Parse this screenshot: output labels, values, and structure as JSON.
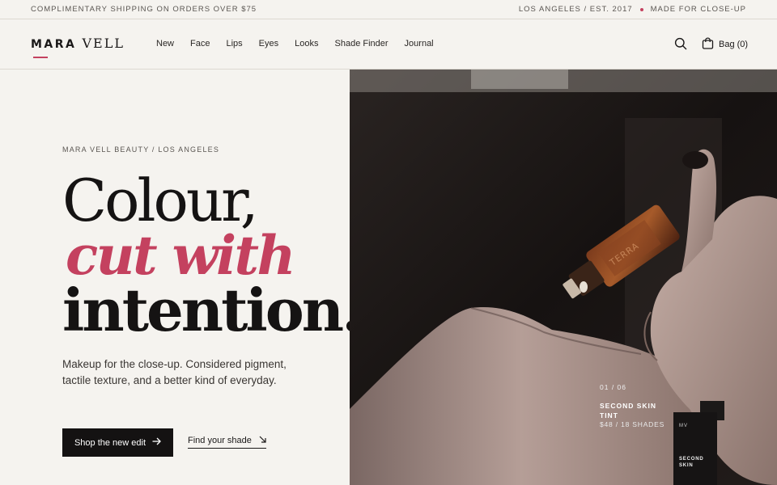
{
  "announcement": {
    "left": "COMPLIMENTARY SHIPPING ON ORDERS OVER $75",
    "right_a": "LOS ANGELES / EST. 2017",
    "right_b": "MADE FOR CLOSE-UP"
  },
  "brand": {
    "first": "MARA",
    "second": "VELL"
  },
  "nav": [
    "New",
    "Face",
    "Lips",
    "Eyes",
    "Looks",
    "Shade Finder",
    "Journal"
  ],
  "header": {
    "bag_label": "Bag (0)",
    "search_icon": "search-icon",
    "bag_icon": "bag-icon"
  },
  "hero": {
    "eyebrow": "MARA VELL BEAUTY / LOS ANGELES",
    "line1": "Colour,",
    "line2": "cut with",
    "line3": "intention.",
    "body": "Makeup for the close-up. Considered pigment, tactile texture, and a better kind of everyday.",
    "cta_primary": "Shop the new edit",
    "cta_secondary": "Find your shade"
  },
  "slide": {
    "counter": "01 / 06",
    "name": "SECOND SKIN TINT",
    "price": "$48 / 18 SHADES",
    "product_mark": "MV",
    "product_name": "SECOND SKIN"
  },
  "colors": {
    "accent": "#c4415f",
    "background": "#f5f3ef",
    "ink": "#141212"
  }
}
